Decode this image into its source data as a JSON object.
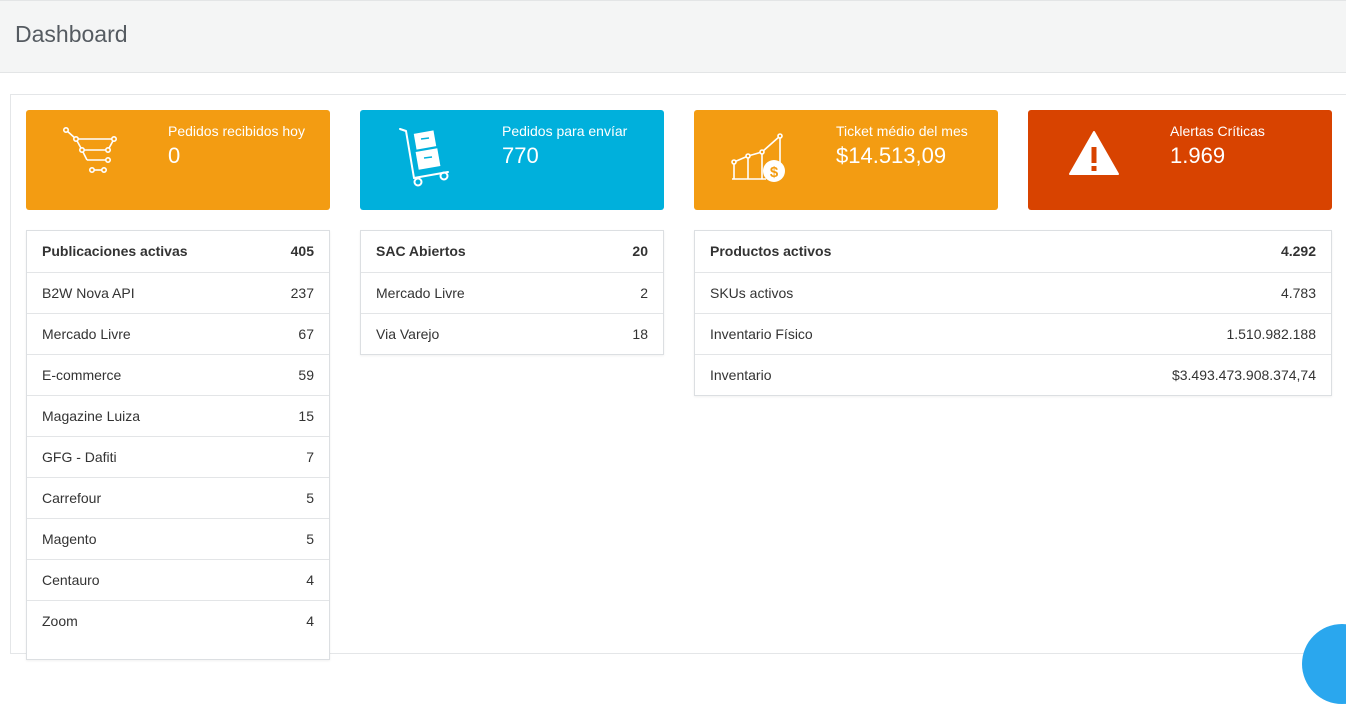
{
  "header": {
    "title": "Dashboard"
  },
  "cards": [
    {
      "label": "Pedidos recibidos hoy",
      "value": "0",
      "color": "#f39c12",
      "icon": "shopping-cart-icon"
    },
    {
      "label": "Pedidos para envíar",
      "value": "770",
      "color": "#00b0dc",
      "icon": "hand-truck-icon"
    },
    {
      "label": "Ticket médio del mes",
      "value": "$14.513,09",
      "color": "#f39c12",
      "icon": "growth-chart-dollar-icon"
    },
    {
      "label": "Alertas Críticas",
      "value": "1.969",
      "color": "#d84300",
      "icon": "warning-icon"
    }
  ],
  "publicaciones": {
    "title": "Publicaciones activas",
    "total": "405",
    "items": [
      {
        "name": "B2W Nova API",
        "count": "237"
      },
      {
        "name": "Mercado Livre",
        "count": "67"
      },
      {
        "name": "E-commerce",
        "count": "59"
      },
      {
        "name": "Magazine Luiza",
        "count": "15"
      },
      {
        "name": "GFG - Dafiti",
        "count": "7"
      },
      {
        "name": "Carrefour",
        "count": "5"
      },
      {
        "name": "Magento",
        "count": "5"
      },
      {
        "name": "Centauro",
        "count": "4"
      },
      {
        "name": "Zoom",
        "count": "4"
      }
    ]
  },
  "sac": {
    "title": "SAC Abiertos",
    "total": "20",
    "items": [
      {
        "name": "Mercado Livre",
        "count": "2"
      },
      {
        "name": "Via Varejo",
        "count": "18"
      }
    ]
  },
  "productos": {
    "title": "Productos activos",
    "total": "4.292",
    "items": [
      {
        "name": "SKUs activos",
        "count": "4.783"
      },
      {
        "name": "Inventario Físico",
        "count": "1.510.982.188"
      },
      {
        "name": "Inventario",
        "count": "$3.493.473.908.374,74"
      }
    ]
  }
}
